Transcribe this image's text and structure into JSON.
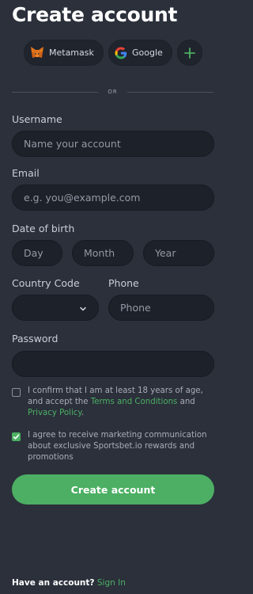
{
  "title": "Create account",
  "social": {
    "metamask_label": "Metamask",
    "metamask_icon": "metamask-fox-icon",
    "google_label": "Google",
    "google_icon": "google-g-icon",
    "more_icon": "plus-icon"
  },
  "divider_text": "OR",
  "username": {
    "label": "Username",
    "placeholder": "Name your account",
    "value": ""
  },
  "email": {
    "label": "Email",
    "placeholder": "e.g. you@example.com",
    "value": ""
  },
  "dob": {
    "label": "Date of birth",
    "day_placeholder": "Day",
    "month_placeholder": "Month",
    "year_placeholder": "Year"
  },
  "country_code": {
    "label": "Country Code",
    "selected": ""
  },
  "phone": {
    "label": "Phone",
    "placeholder": "Phone",
    "value": ""
  },
  "password": {
    "label": "Password",
    "value": ""
  },
  "age_confirm": {
    "checked": false,
    "text_before": "I confirm that I am at least 18 years of age, and accept the ",
    "terms_link": "Terms and Conditions",
    "text_and": " and ",
    "privacy_link": "Privacy Policy",
    "text_end": "."
  },
  "marketing": {
    "checked": true,
    "text": "I agree to receive marketing communication about exclusive Sportsbet.io rewards and promotions"
  },
  "submit_label": "Create account",
  "footer": {
    "question": "Have an account?",
    "signin_link": "Sign In"
  },
  "colors": {
    "background": "#2b303b",
    "field_bg": "#1d212a",
    "accent_green": "#4caf63",
    "text_primary": "#ffffff"
  }
}
